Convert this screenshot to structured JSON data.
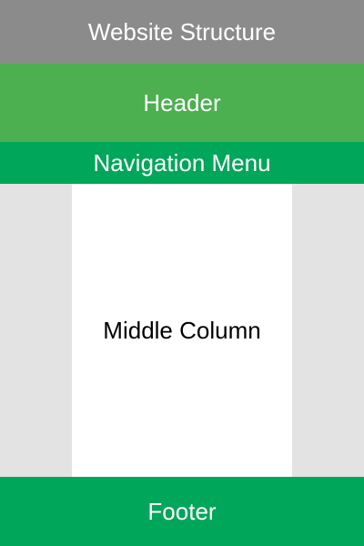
{
  "diagram": {
    "title": "Website Structure",
    "header": "Header",
    "navigation": "Navigation Menu",
    "middle_column": "Middle Column",
    "footer": "Footer"
  },
  "colors": {
    "title_band": "#8b8b8b",
    "header_band": "#4caf50",
    "navigation_band": "#00a65a",
    "side_columns": "#e3e3e3",
    "middle_column": "#ffffff",
    "footer_band": "#00a65a"
  }
}
